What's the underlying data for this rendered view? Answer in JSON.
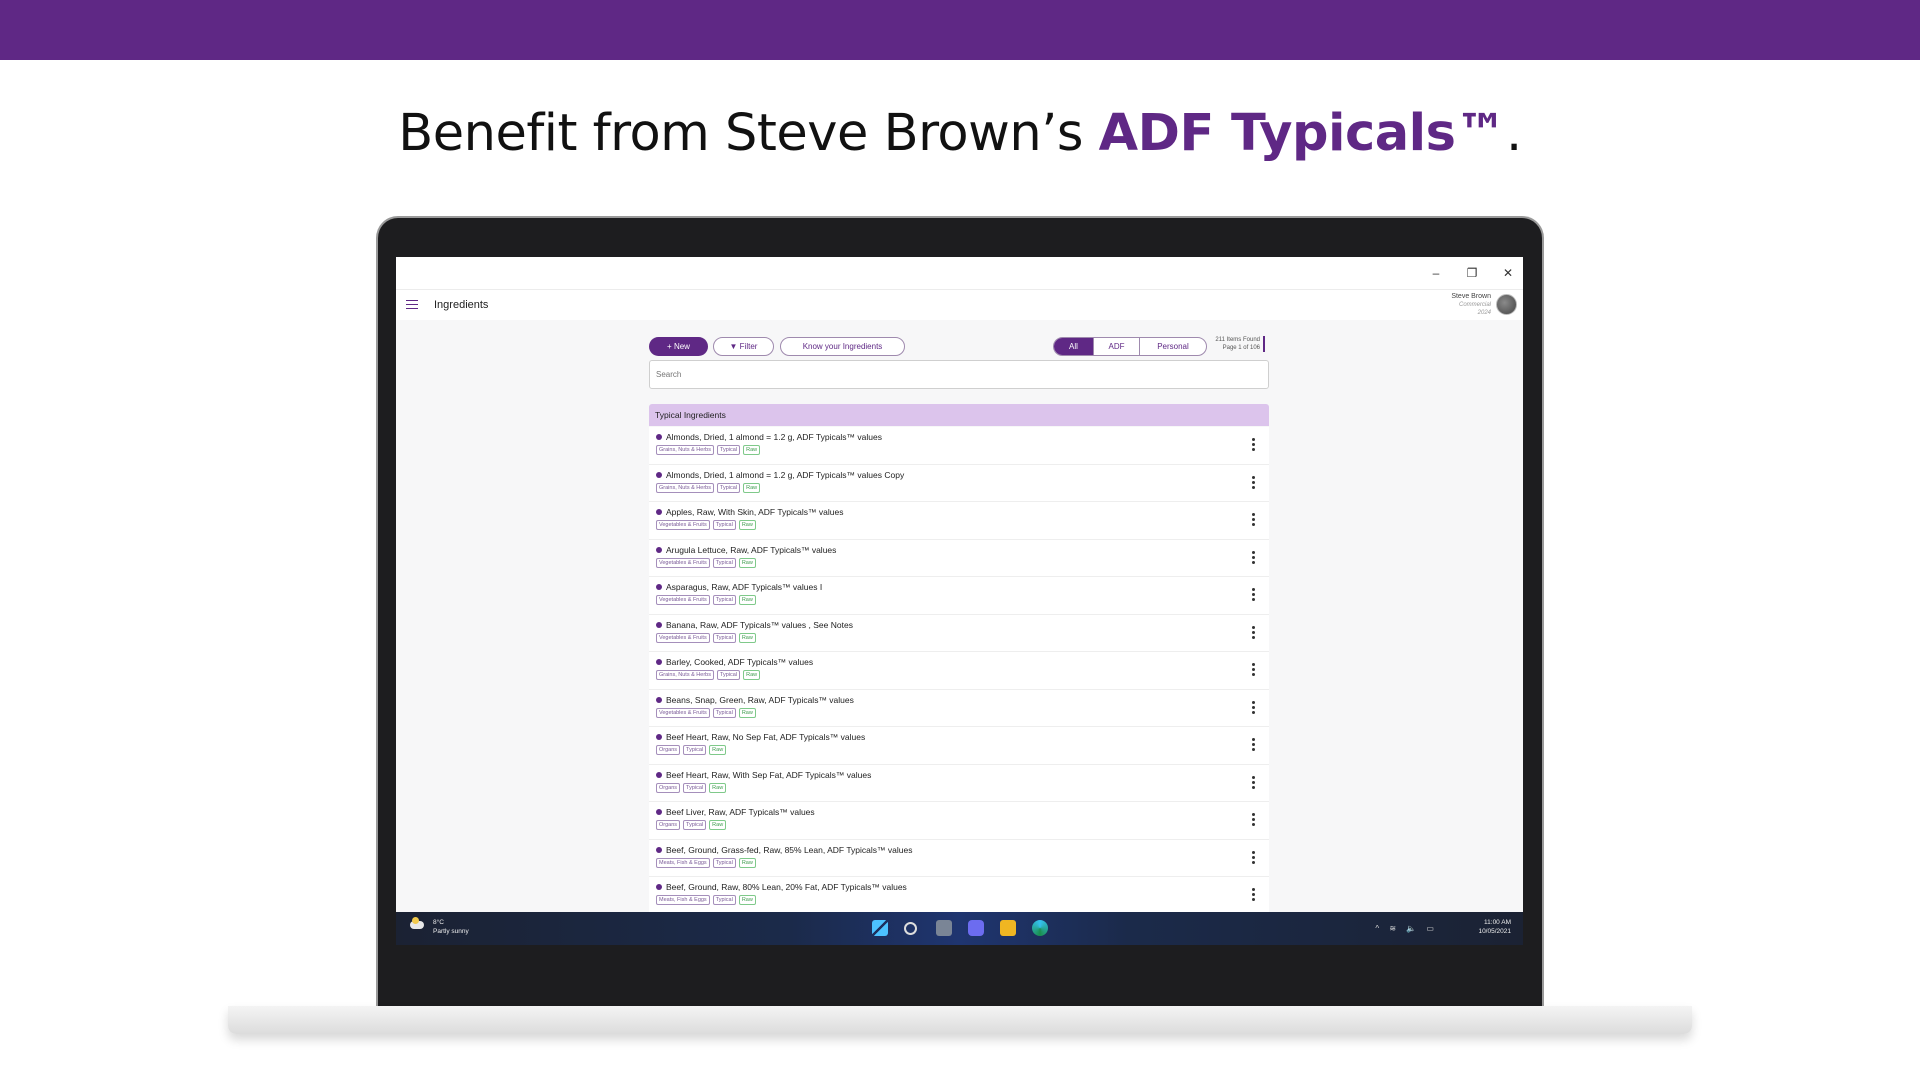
{
  "banner": {
    "headline_prefix": "Benefit from Steve Brown’s ",
    "headline_accent": "ADF Typicals™",
    "headline_suffix": "."
  },
  "window": {
    "minimize": "–",
    "maximize": "❐",
    "close": "✕"
  },
  "app": {
    "title": "Ingredients",
    "user_name": "Steve Brown",
    "user_role": "Commercial",
    "user_extra": "2024"
  },
  "toolbar": {
    "new_label": "+ New",
    "filter_label": "▼ Filter",
    "know_label": "Know your Ingredients",
    "segments": [
      "All",
      "ADF",
      "Personal"
    ],
    "items_found": "211 Items Found",
    "page_info": "Page 1 of 106",
    "search_placeholder": "Search"
  },
  "section_title": "Typical Ingredients",
  "ingredients": [
    {
      "name": "Almonds, Dried, 1 almond = 1.2 g,  ADF Typicals™ values",
      "category": "Grains, Nuts & Herbs",
      "type": "Typical",
      "state": "Raw"
    },
    {
      "name": "Almonds, Dried, 1 almond = 1.2 g,  ADF Typicals™ values Copy",
      "category": "Grains, Nuts & Herbs",
      "type": "Typical",
      "state": "Raw"
    },
    {
      "name": "Apples, Raw, With Skin, ADF Typicals™ values",
      "category": "Vegetables & Fruits",
      "type": "Typical",
      "state": "Raw"
    },
    {
      "name": "Arugula Lettuce, Raw, ADF Typicals™ values",
      "category": "Vegetables & Fruits",
      "type": "Typical",
      "state": "Raw"
    },
    {
      "name": "Asparagus, Raw,  ADF Typicals™ values  I",
      "category": "Vegetables & Fruits",
      "type": "Typical",
      "state": "Raw"
    },
    {
      "name": "Banana, Raw,  ADF Typicals™ values , See Notes",
      "category": "Vegetables & Fruits",
      "type": "Typical",
      "state": "Raw"
    },
    {
      "name": "Barley, Cooked,  ADF Typicals™ values",
      "category": "Grains, Nuts & Herbs",
      "type": "Typical",
      "state": "Raw"
    },
    {
      "name": "Beans, Snap, Green, Raw,  ADF Typicals™ values",
      "category": "Vegetables & Fruits",
      "type": "Typical",
      "state": "Raw"
    },
    {
      "name": "Beef Heart, Raw, No Sep Fat, ADF Typicals™ values",
      "category": "Organs",
      "type": "Typical",
      "state": "Raw"
    },
    {
      "name": "Beef Heart, Raw, With Sep Fat, ADF Typicals™ values",
      "category": "Organs",
      "type": "Typical",
      "state": "Raw"
    },
    {
      "name": "Beef Liver, Raw, ADF Typicals™ values",
      "category": "Organs",
      "type": "Typical",
      "state": "Raw"
    },
    {
      "name": "Beef, Ground, Grass-fed, Raw, 85% Lean, ADF Typicals™ values",
      "category": "Meats, Fish & Eggs",
      "type": "Typical",
      "state": "Raw"
    },
    {
      "name": "Beef, Ground, Raw, 80% Lean, 20% Fat, ADF Typicals™ values",
      "category": "Meats, Fish & Eggs",
      "type": "Typical",
      "state": "Raw"
    }
  ],
  "taskbar": {
    "temperature": "8°C",
    "weather": "Partly sunny",
    "time": "11:00 AM",
    "date": "10/05/2021",
    "tray_symbols": "^ ≋ 🔈 ▭"
  },
  "colors": {
    "brand": "#5f2885",
    "section_bg": "#dcc4ec",
    "raw_tag": "#3f9d4f"
  }
}
